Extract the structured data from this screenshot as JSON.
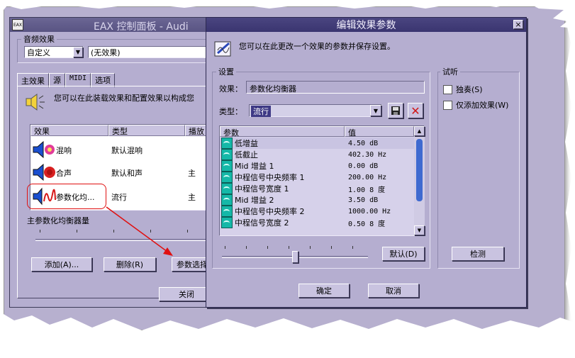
{
  "back": {
    "title": "EAX 控制面板 - Audi",
    "sound_effects_label": "音频效果",
    "preset_value": "自定义",
    "effect_field": "(无效果)",
    "tabs": [
      "主效果",
      "源",
      "MIDI",
      "选项"
    ],
    "description": "您可以在此装载效果和配置效果以构成您",
    "list_headers": [
      "效果",
      "类型",
      "播放"
    ],
    "effects": [
      {
        "name": "混响",
        "type": "默认混响",
        "play": ""
      },
      {
        "name": "合声",
        "type": "默认和声",
        "play": "主"
      },
      {
        "name": "参数化均...",
        "type": "流行",
        "play": "主"
      }
    ],
    "slider_label": "主参数化均衡器量",
    "buttons": {
      "add": "添加(A)...",
      "delete": "删除(R)",
      "params": "参数选择",
      "close": "关闭"
    }
  },
  "dialog": {
    "title": "编辑效果参数",
    "close_glyph": "×",
    "intro": "您可以在此更改一个效果的参数并保存设置。",
    "settings_label": "设置",
    "effect_label": "效果：",
    "effect_value": "参数化均衡器",
    "type_label": "类型：",
    "type_value": "流行",
    "param_headers": [
      "参数",
      "值"
    ],
    "params": [
      {
        "name": "低增益",
        "value": "4.50 dB"
      },
      {
        "name": "低截止",
        "value": "402.30 Hz"
      },
      {
        "name": "Mid 增益 1",
        "value": "0.00 dB"
      },
      {
        "name": "中程信号中央频率 1",
        "value": "200.00 Hz"
      },
      {
        "name": "中程信号宽度 1",
        "value": "1.00 8 度"
      },
      {
        "name": "Mid 增益 2",
        "value": "3.50 dB"
      },
      {
        "name": "中程信号中央频率 2",
        "value": "1000.00 Hz"
      },
      {
        "name": "中程信号宽度 2",
        "value": "0.50 8 度"
      }
    ],
    "default_button": "默认(D)",
    "slider_value": 0.5,
    "audition_label": "试听",
    "solo_label": "独奏(S)",
    "add_only_label": "仅添加效果(W)",
    "detect_button": "检测",
    "ok_button": "确定",
    "cancel_button": "取消"
  },
  "colors": {
    "window_bg": "#b5aed0",
    "annotation_red": "#e01010",
    "selection": "#3f3a86"
  }
}
